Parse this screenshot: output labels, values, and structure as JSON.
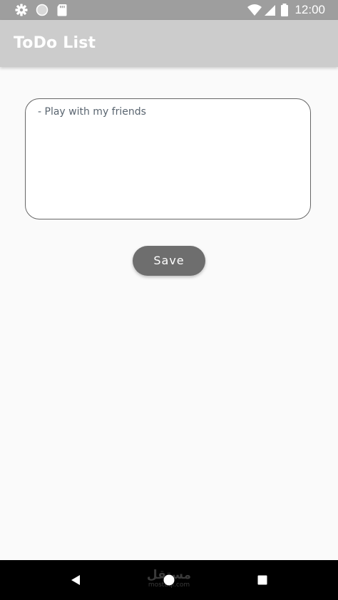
{
  "status_bar": {
    "time": "12:00",
    "icons": [
      "gear-icon",
      "circle-icon",
      "sd-card-icon",
      "wifi-icon",
      "signal-icon",
      "battery-icon"
    ]
  },
  "app_bar": {
    "title": "ToDo List"
  },
  "todo": {
    "value": "- Play with my friends"
  },
  "actions": {
    "save_label": "Save"
  },
  "nav_bar": {
    "icons": [
      "back-icon",
      "home-icon",
      "recents-icon"
    ]
  },
  "watermark": {
    "text_arabic": "مستقل",
    "text_latin": "mostaql.com"
  },
  "colors": {
    "status_bar": "#9e9e9e",
    "app_bar": "#cccccc",
    "background": "#fafafa",
    "button": "#6e6e6e",
    "nav_bar": "#000000"
  }
}
